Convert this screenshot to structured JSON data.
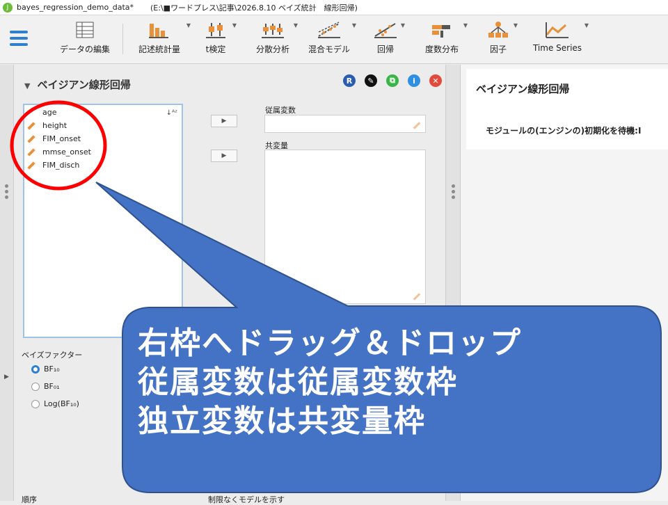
{
  "window": {
    "filename": "bayes_regression_demo_data*",
    "path": "(E:\\■ワードプレス\\記事\\2026.8.10 ベイズ統計　線形回帰)"
  },
  "ribbon": {
    "tools": [
      {
        "label": "データの編集",
        "icon": "data-table-icon"
      },
      {
        "label": "記述統計量",
        "icon": "bar-chart-icon"
      },
      {
        "label": "t検定",
        "icon": "ttest-icon"
      },
      {
        "label": "分散分析",
        "icon": "anova-icon"
      },
      {
        "label": "混合モデル",
        "icon": "mixed-model-icon"
      },
      {
        "label": "回帰",
        "icon": "regression-icon"
      },
      {
        "label": "度数分布",
        "icon": "frequency-icon"
      },
      {
        "label": "因子",
        "icon": "factor-icon"
      },
      {
        "label": "Time Series",
        "icon": "time-series-icon"
      }
    ],
    "accent": "#2f7fd1"
  },
  "analysis": {
    "title": "ベイジアン線形回帰",
    "header_icons": [
      {
        "name": "r-syntax-icon",
        "glyph": "R",
        "color": "#2a5db0"
      },
      {
        "name": "edit-title-icon",
        "glyph": "✎",
        "color": "#111111"
      },
      {
        "name": "duplicate-icon",
        "glyph": "⧉",
        "color": "#3bb44a"
      },
      {
        "name": "info-icon",
        "glyph": "i",
        "color": "#2f8fe0"
      },
      {
        "name": "close-icon",
        "glyph": "✕",
        "color": "#e24a3b"
      }
    ],
    "variables": [
      "age",
      "height",
      "FIM_onset",
      "mmse_onset",
      "FIM_disch"
    ],
    "dependent_label": "従属変数",
    "covariates_label": "共変量",
    "bayes_factor_label": "ベイズファクター",
    "bf_options": [
      {
        "label": "BF₁₀",
        "selected": true
      },
      {
        "label": "BF₀₁",
        "selected": false
      },
      {
        "label": "Log(BF₁₀)",
        "selected": false
      }
    ],
    "order_label": "順序",
    "model_limit_label": "制限なくモデルを示す"
  },
  "results": {
    "title": "ベイジアン線形回帰",
    "message": "モジュールの(エンジンの)初期化を待機:",
    "truncated_suffix": "I"
  },
  "annotation": {
    "lines": [
      "右枠へドラッグ＆ドロップ",
      "従属変数は従属変数枠",
      "独立変数は共変量枠"
    ],
    "fill": "#4472c4",
    "highlight": "#ff0000"
  }
}
